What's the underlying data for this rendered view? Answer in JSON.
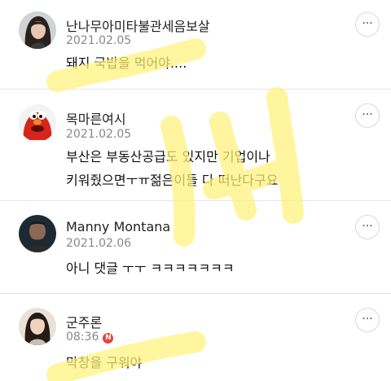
{
  "comments": [
    {
      "author": "난나무아미타불관세음보살",
      "date": "2021.02.05",
      "text": [
        "돼지 국밥을 먹어야...."
      ],
      "avatar_icon": "woman-portrait-avatar"
    },
    {
      "author": "목마른여시",
      "date": "2021.02.05",
      "text": [
        "부산은 부동산공급도 있지만 기업이나",
        "키워줬으면ㅜㅠ젊은이들 다 떠난다구요"
      ],
      "avatar_icon": "red-monster-avatar"
    },
    {
      "author": "Manny Montana",
      "date": "2021.02.06",
      "text": [
        "아니 댓글 ㅜㅜ ㅋㅋㅋㅋㅋㅋㅋ"
      ],
      "avatar_icon": "man-portrait-avatar"
    },
    {
      "author": "군주론",
      "date": "08:36",
      "badge": "N",
      "text": [
        "막창을 구워야"
      ],
      "avatar_icon": "girl-portrait-avatar"
    }
  ],
  "more_button_label": "···",
  "watermark_color": "#fff27a"
}
